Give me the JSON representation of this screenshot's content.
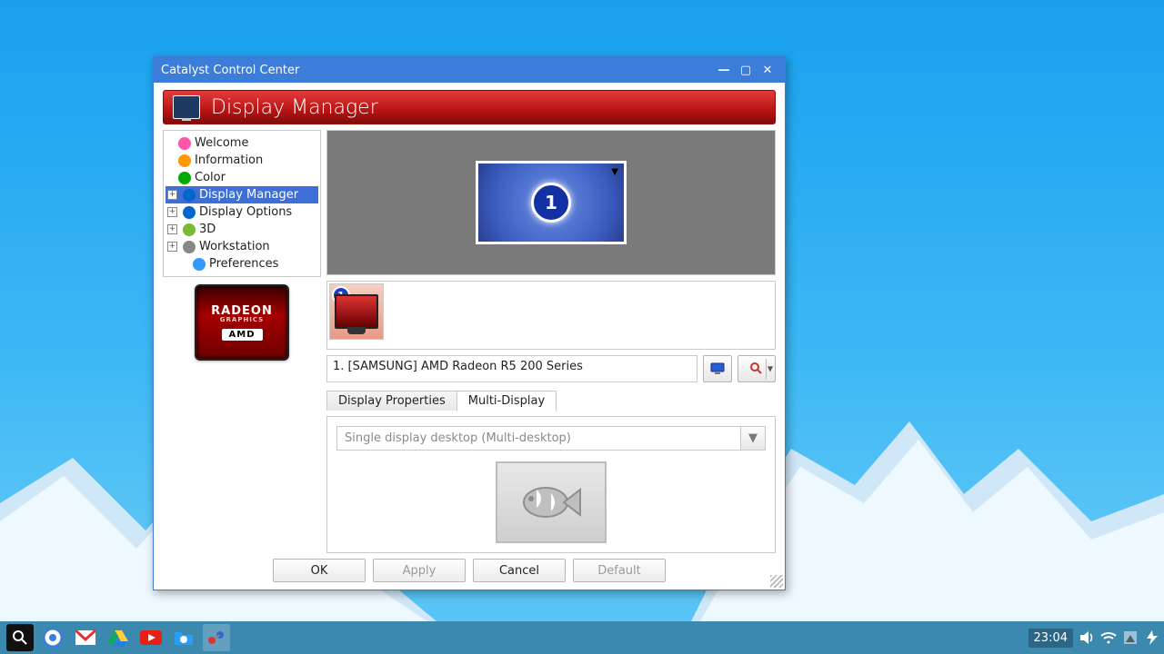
{
  "window": {
    "title": "Catalyst Control Center",
    "banner": "Display Manager"
  },
  "tree": {
    "items": [
      {
        "label": "Welcome",
        "expand": "",
        "indent": false
      },
      {
        "label": "Information",
        "expand": "",
        "indent": false
      },
      {
        "label": "Color",
        "expand": "",
        "indent": false
      },
      {
        "label": "Display Manager",
        "expand": "+",
        "indent": false,
        "selected": true
      },
      {
        "label": "Display Options",
        "expand": "+",
        "indent": false
      },
      {
        "label": "3D",
        "expand": "+",
        "indent": false
      },
      {
        "label": "Workstation",
        "expand": "+",
        "indent": false
      },
      {
        "label": "Preferences",
        "expand": "",
        "indent": true
      }
    ]
  },
  "preview": {
    "display_number": "1"
  },
  "device": {
    "label": "1.  [SAMSUNG] AMD Radeon R5 200 Series"
  },
  "tabs": {
    "prop": "Display Properties",
    "multi": "Multi-Display"
  },
  "multi": {
    "mode": "Single display desktop (Multi-desktop)"
  },
  "buttons": {
    "ok": "OK",
    "apply": "Apply",
    "cancel": "Cancel",
    "default": "Default"
  },
  "brand": {
    "line1": "RADEON",
    "line2": "GRAPHICS",
    "line3": "AMD"
  },
  "taskbar": {
    "clock": "23:04"
  }
}
